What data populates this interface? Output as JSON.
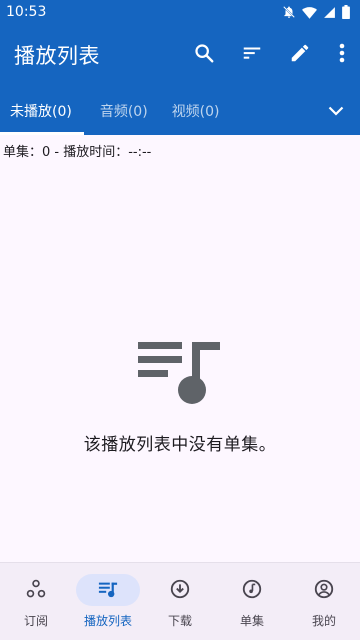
{
  "status_bar": {
    "time": "10:53",
    "icons": [
      "notifications-off-icon",
      "wifi-icon",
      "signal-icon",
      "battery-icon"
    ]
  },
  "app_bar": {
    "title": "播放列表",
    "actions": [
      "search-icon",
      "sort-icon",
      "edit-icon",
      "more-vert-icon"
    ]
  },
  "tabs": [
    {
      "label": "未播放(0)",
      "active": true
    },
    {
      "label": "音频(0)",
      "active": false
    },
    {
      "label": "视频(0)",
      "active": false
    }
  ],
  "info_line": "单集：0 - 播放时间：--:--",
  "empty_state": {
    "icon": "playlist-music-icon",
    "message": "该播放列表中没有单集。"
  },
  "bottom_nav": [
    {
      "label": "订阅",
      "icon": "subscriptions-icon",
      "active": false
    },
    {
      "label": "播放列表",
      "icon": "playlist-music-icon",
      "active": true
    },
    {
      "label": "下载",
      "icon": "download-icon",
      "active": false
    },
    {
      "label": "单集",
      "icon": "music-note-icon",
      "active": false
    },
    {
      "label": "我的",
      "icon": "account-icon",
      "active": false
    }
  ],
  "colors": {
    "primary": "#1565c0",
    "background": "#fdf7ff",
    "nav_background": "#f3edf7",
    "nav_active_pill": "#dde3fb",
    "text": "#1d1b20",
    "icon_gray": "#5f6368"
  }
}
